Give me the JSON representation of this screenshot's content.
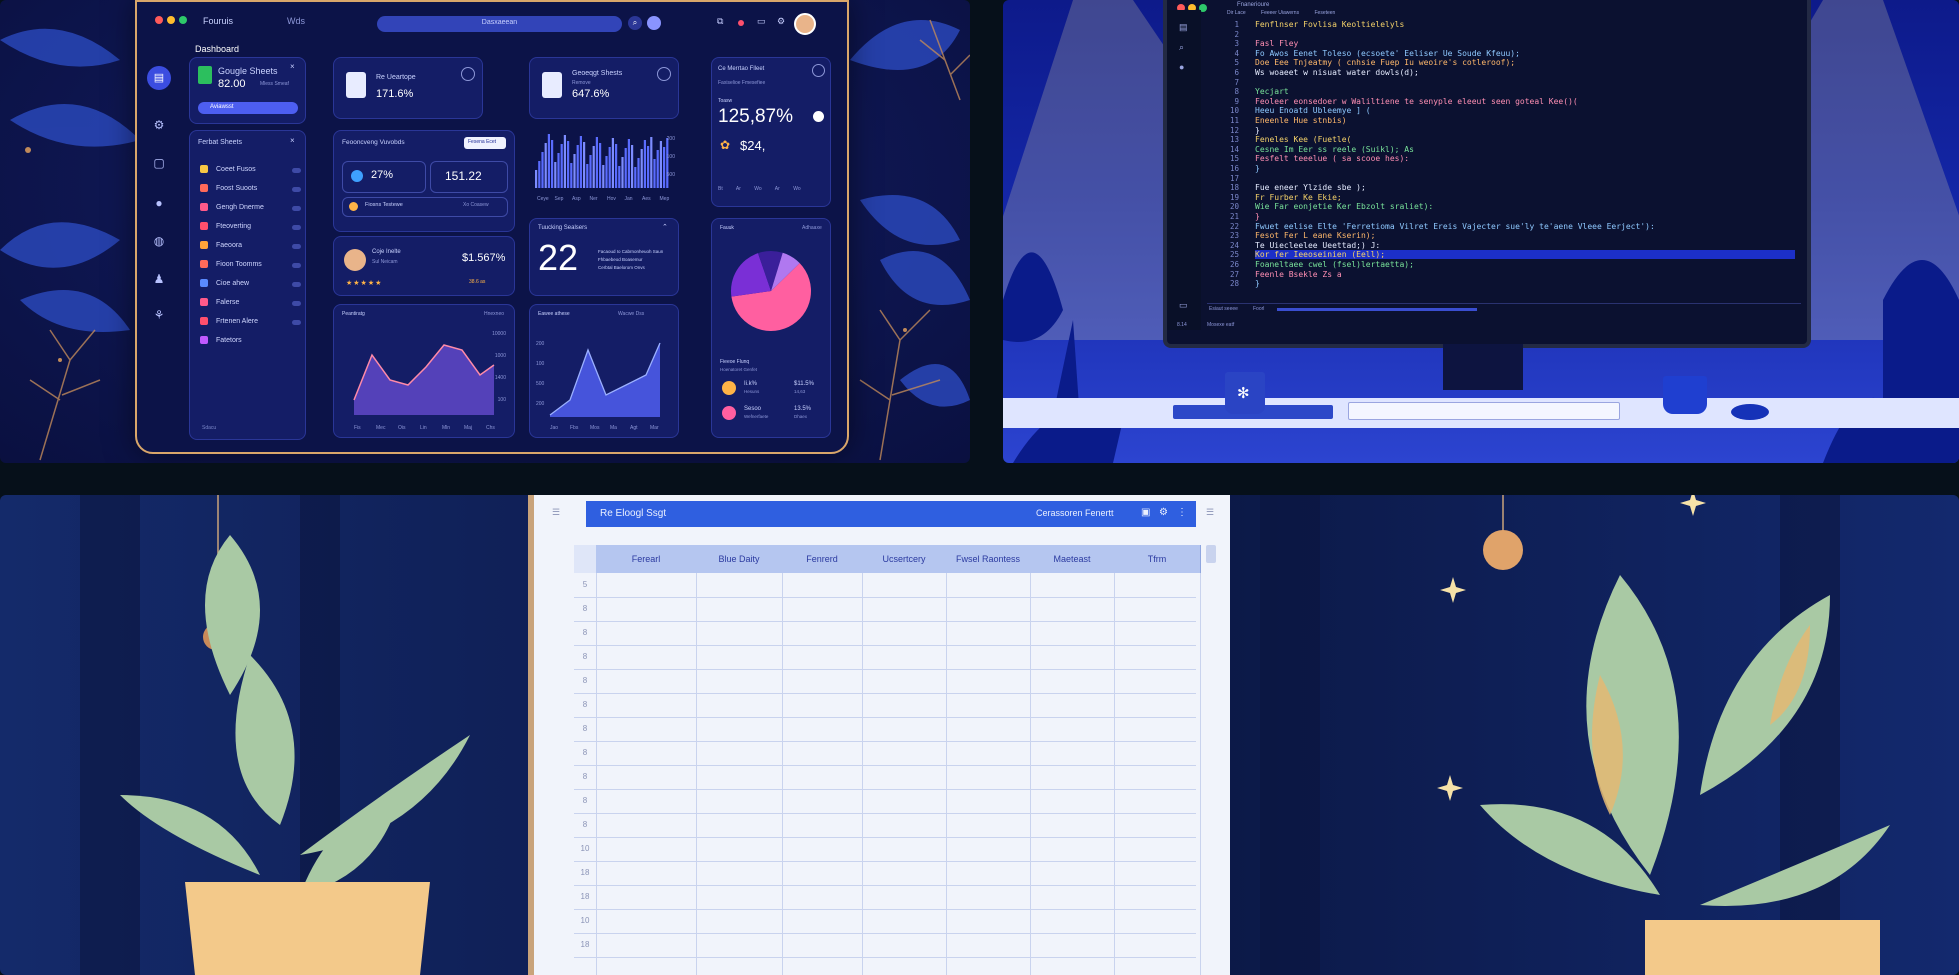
{
  "dashboard": {
    "top_app": "Fouruis",
    "top_menu": "Wds",
    "search_placeholder": "Dasxaeean",
    "page_title": "Dashboard",
    "card_google": {
      "title": "Gougle Sheets",
      "value": "82.00",
      "sub": "Mless Smeaf",
      "button": "Aviawsst"
    },
    "card_sheet2": {
      "title": "Re Ueartope",
      "value": "171.6%"
    },
    "card_sheet3": {
      "title": "Geoeqgt Shests",
      "sub": "Remove",
      "value": "647.6%"
    },
    "card_right_top": {
      "title": "Ce Merrtao Flleet",
      "sub": "Faxiselioe Fmesefiee",
      "label": "Toasw",
      "value": "125,87%",
      "value2": "$24,",
      "ticks": [
        "Bt",
        "Ar",
        "Wo",
        "Ar",
        "Wo"
      ]
    },
    "recent_sheets": {
      "title": "Ferbat Sheets",
      "items": [
        "Coeet Fusos",
        "Foost Suoots",
        "Gengh Dnerme",
        "Fteoverting",
        "Faeoora",
        "Fioon Toomms",
        "Cioe ahew",
        "Falerse",
        "Frtenen Alere",
        "Fatetors"
      ]
    },
    "reconcile": {
      "title": "Feooncveng Vuvobds",
      "button": "Fesena Ecet",
      "pct": "27%",
      "val": "151.22",
      "row": "Fiosns Testewe",
      "row_right": "Xo Coasew"
    },
    "user": {
      "name": "Coje Inelte",
      "role": "Sul Neicam",
      "value": "$1.567%",
      "sub": "38.6 as"
    },
    "tracking": {
      "title": "Tuucking Sealsers",
      "number": "22",
      "lines": [
        "Facaoud Io Cabrnonheuoh Saun",
        "Fhbaebeod Boasemur",
        "Cerbtal Baelorom Onvs"
      ]
    },
    "mini_chart": {
      "xlabels": [
        "Ceye",
        "Sep",
        "Asp",
        "Ner",
        "Hov",
        "Jan",
        "Aes",
        "Mep"
      ],
      "ylabels": [
        "200",
        "100",
        "500"
      ]
    },
    "left_chart": {
      "title": "Peantiratg",
      "right": "Hnexneo",
      "ylabels": [
        "10000",
        "1000",
        "1400",
        "100"
      ],
      "xlabels": [
        "Fis",
        "Mec",
        "Ois",
        "Lin",
        "Mln",
        "Maj",
        "Chs"
      ]
    },
    "right_chart": {
      "title": "Eawee athese",
      "legend": [
        "Wacwe",
        "Dss"
      ],
      "ylabels": [
        "200",
        "100",
        "500",
        "200"
      ],
      "xlabels": [
        "Jao",
        "Fbs",
        "Mos",
        "Ma",
        "Agt",
        "Mar"
      ]
    },
    "pie": {
      "title": "Fauuk",
      "right": "Adhaaxe",
      "values": [
        60,
        22,
        10,
        8
      ],
      "colors": [
        "#ff5fa0",
        "#7a2fd6",
        "#3a1f9a",
        "#b078f0"
      ]
    },
    "pie_legend": {
      "title": "Fieeoe Flunq",
      "sub": "Hoenatoret Genfet",
      "items": [
        {
          "name": "Ii.k%",
          "sub": "Hesuns",
          "value": "$11.5%",
          "value2": "14,63"
        },
        {
          "name": "Sesoo",
          "sub": "Wefnerfaete",
          "value": "13.5%",
          "value2": "Dhaex"
        }
      ]
    },
    "sidebar_bottom": "Sdacu"
  },
  "code_editor": {
    "tab_title": "Fnanerioure",
    "tabs": [
      "Dir Lace",
      "Feeeer Uiawerns",
      "Feseteen"
    ],
    "lines": [
      "Fenflnser Fovlisa Keoltielelyls",
      "",
      "Fasl Fley",
      "Fo Awos Eenet Toleso (ecsoete' Eeliser Ue Soude Kfeuu);",
      "  Doe Eee Tnjeatmy ( cnhsie Fuep Iu weoire's cotleroof);",
      "  Ws woaeet w nisuat water dowls(d);",
      "",
      "Yecjart",
      "  Feoleer eonsedoer w Waliltiene te senyple eleeut seen goteal Kee()(",
      "  Heeu Enoatd Ubleemye ] (",
      "  Eneenle Hue stnbis)",
      "}",
      "Feneles Kee (Fuetle(",
      "  Cesne Im Eer ss reele (Suikl); As",
      "  Fesfelt teeelue ( sa scooe hes):",
      "}",
      "",
      "  Fue eneer Ylzide sbe );",
      "  Fr Furber Ke Ekie;",
      "  Wie Far eonjetie Ker Ebzolt sraliet):",
      "}",
      "Fwuet eelise Elte 'Ferretioma Vilret Ereis Vajecter sue'ly te'aene Vleee Eerject'):",
      "  Fesot Fer L eane Kserin);",
      "  Te Uiecleelee Ueettad;) J:",
      "  Kor fer Ieeoseinien (Eell);",
      "    Foaneltaee cwel (fsel)lertaetta);",
      "  Feenle Bsekle Zs a",
      "}"
    ],
    "status_left": "8.14",
    "status_label": "Mosexe eatf",
    "bottom_tabs": [
      "Esiaut seeee",
      "Foorl"
    ]
  },
  "spreadsheet": {
    "title": "Re Eloogl Ssgt",
    "title_right": "Cerassoren Fenertt",
    "columns": [
      "Ferearl",
      "Blue Daity",
      "Fenrerd",
      "Ucsertcery",
      "Fwsel Raontess",
      "Maeteast",
      "Tfrm"
    ],
    "row_numbers": [
      "5",
      "8",
      "8",
      "8",
      "8",
      "8",
      "8",
      "8",
      "8",
      "8",
      "8",
      "10",
      "18",
      "18",
      "10",
      "18"
    ]
  }
}
